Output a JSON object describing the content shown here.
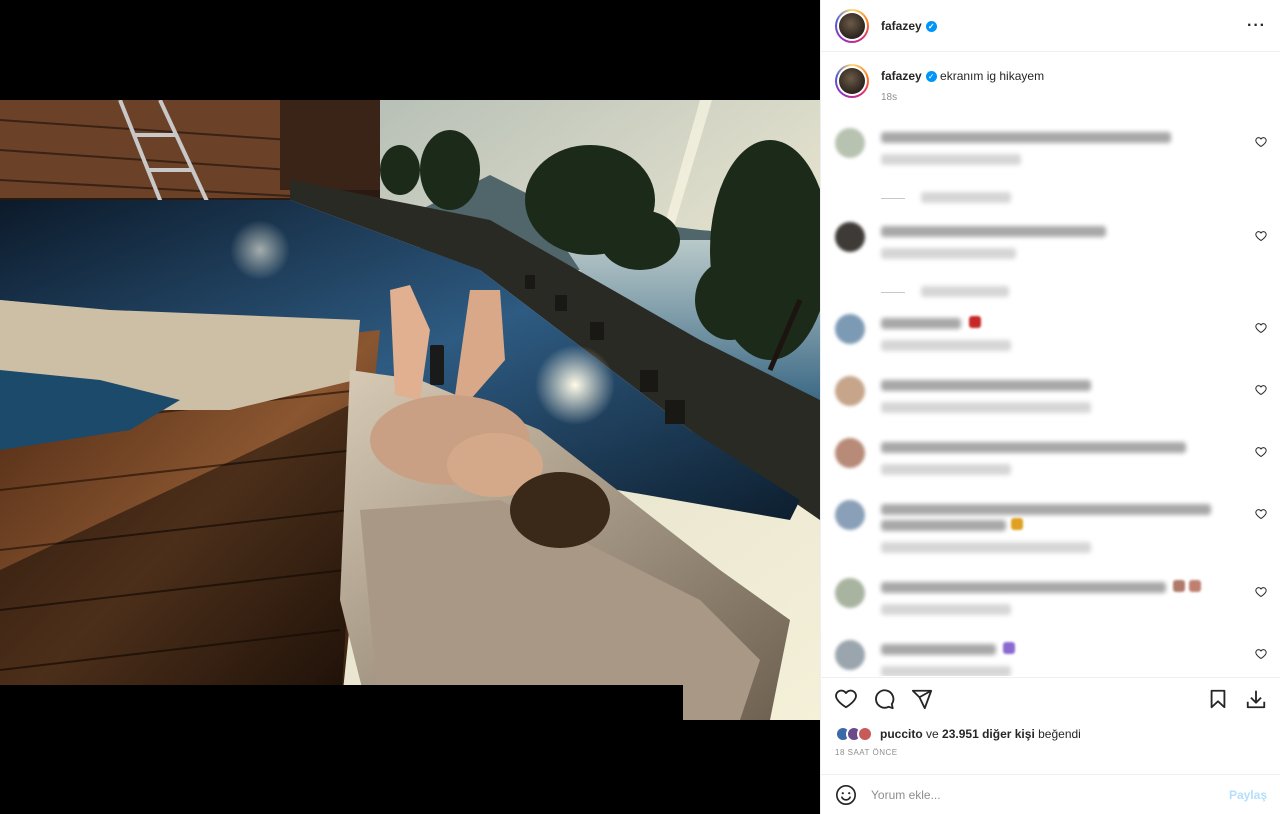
{
  "header": {
    "username": "fafazey",
    "verified_icon": "verified-badge-icon",
    "more_icon": "more-options-icon",
    "more_label": "···"
  },
  "caption": {
    "username": "fafazey",
    "text": "ekranım ig hikayem",
    "time": "18s"
  },
  "comments": {
    "note": "",
    "items": [
      {
        "avatar_color": "#b7c3b0"
      },
      {
        "avatar_color": "#3e3a35"
      },
      {
        "avatar_color": "#7d9ab5"
      },
      {
        "avatar_color": "#c6a58a"
      },
      {
        "avatar_color": "#b88a78"
      },
      {
        "avatar_color": "#8aa0b8"
      },
      {
        "avatar_color": "#a8b4a0"
      },
      {
        "avatar_color": "#9aa5ad"
      }
    ]
  },
  "actions": {
    "like_icon": "heart-icon",
    "comment_icon": "comment-icon",
    "share_icon": "share-icon",
    "save_icon": "bookmark-icon",
    "download_icon": "download-icon"
  },
  "likes": {
    "first_user": "puccito",
    "connector": "ve",
    "others": "23.951 diğer kişi",
    "suffix": "beğendi"
  },
  "time_ago": "18 SAAT ÖNCE",
  "add_comment": {
    "placeholder": "Yorum ekle...",
    "post_label": "Paylaş",
    "emoji_icon": "emoji-icon"
  },
  "colors": {
    "verified_blue": "#0095f6",
    "post_button_disabled": "#b2dffc"
  }
}
